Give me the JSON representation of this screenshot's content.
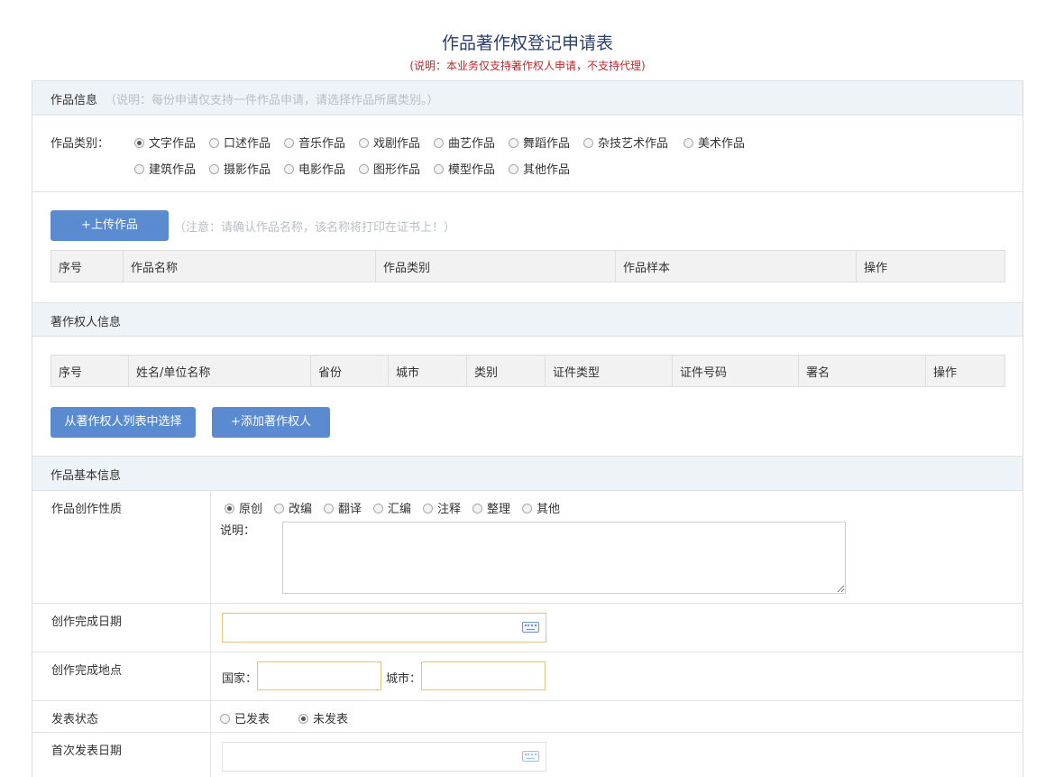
{
  "header": {
    "title": "作品著作权登记申请表",
    "subtitle": "(说明：本业务仅支持著作权人申请，不支持代理)"
  },
  "work_info": {
    "section_label": "作品信息",
    "section_note": "（说明：每份申请仅支持一件作品申请，请选择作品所属类别。）",
    "category_label": "作品类别：",
    "categories_row1": [
      "文字作品",
      "口述作品",
      "音乐作品",
      "戏剧作品",
      "曲艺作品",
      "舞蹈作品",
      "杂技艺术作品",
      "美术作品"
    ],
    "categories_row2": [
      "建筑作品",
      "摄影作品",
      "电影作品",
      "图形作品",
      "模型作品",
      "其他作品"
    ],
    "selected_category": "文字作品",
    "upload_button": "+上传作品",
    "upload_note": "（注意：请确认作品名称，该名称将打印在证书上！）",
    "table_headers": [
      "序号",
      "作品名称",
      "作品类别",
      "作品样本",
      "操作"
    ]
  },
  "owner_info": {
    "section_label": "著作权人信息",
    "table_headers": [
      "序号",
      "姓名/单位名称",
      "省份",
      "城市",
      "类别",
      "证件类型",
      "证件号码",
      "署名",
      "操作"
    ],
    "select_button": "从著作权人列表中选择",
    "add_button": "+添加著作权人"
  },
  "basic_info": {
    "section_label": "作品基本信息",
    "nature_label": "作品创作性质",
    "nature_options": [
      "原创",
      "改编",
      "翻译",
      "汇编",
      "注释",
      "整理",
      "其他"
    ],
    "selected_nature": "原创",
    "desc_label": "说明：",
    "completion_date_label": "创作完成日期",
    "completion_place_label": "创作完成地点",
    "country_label": "国家：",
    "city_label": "城市：",
    "publish_status_label": "发表状态",
    "publish_options": [
      "已发表",
      "未发表"
    ],
    "selected_publish": "未发表",
    "first_publish_date_label": "首次发表日期"
  },
  "icons": {
    "date_picker": "keyboard-icon",
    "radio": "radio-icon"
  },
  "colors": {
    "title": "#2b3e6c",
    "subtitle": "#c0282d",
    "button": "#5a8ad0",
    "section_bar": "#eef3f7",
    "input_border": "#e8c27a"
  }
}
